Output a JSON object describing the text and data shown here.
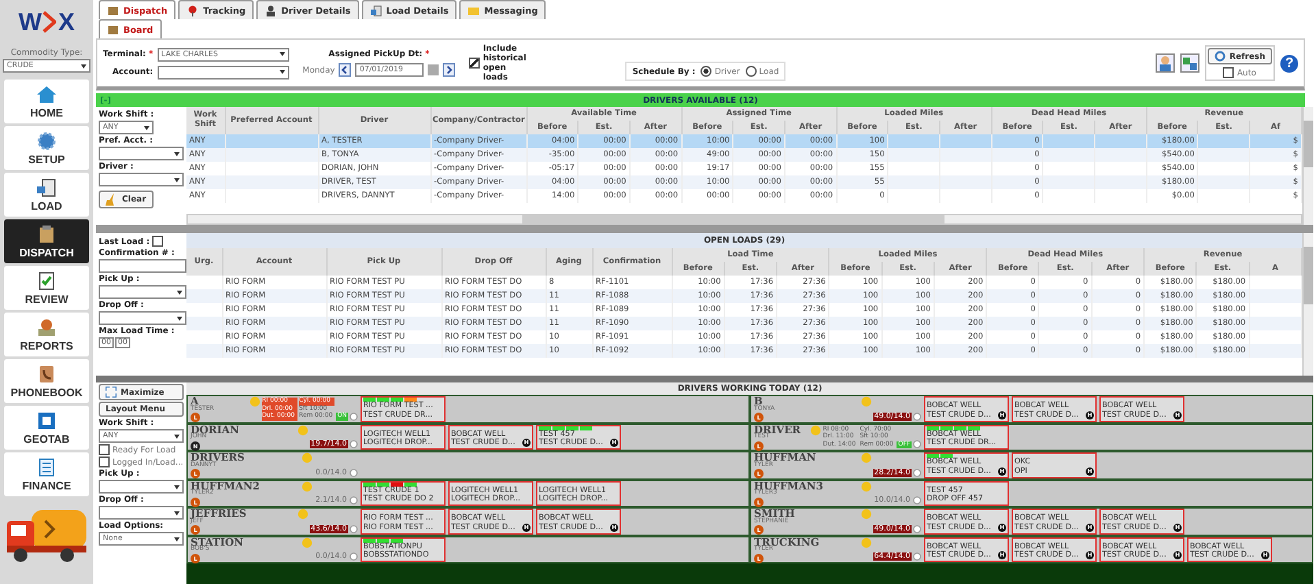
{
  "logo": {
    "left": "W",
    "right": "X"
  },
  "commodity": {
    "label": "Commodity Type:",
    "value": "CRUDE"
  },
  "nav": [
    {
      "label": "HOME",
      "selected": false
    },
    {
      "label": "SETUP",
      "selected": false
    },
    {
      "label": "LOAD",
      "selected": false
    },
    {
      "label": "DISPATCH",
      "selected": true
    },
    {
      "label": "REVIEW",
      "selected": false
    },
    {
      "label": "REPORTS",
      "selected": false
    },
    {
      "label": "PHONEBOOK",
      "selected": false
    },
    {
      "label": "GEOTAB",
      "selected": false
    },
    {
      "label": "FINANCE",
      "selected": false
    }
  ],
  "tabs": [
    {
      "label": "Dispatch",
      "selected": true
    },
    {
      "label": "Tracking",
      "selected": false
    },
    {
      "label": "Driver Details",
      "selected": false
    },
    {
      "label": "Load Details",
      "selected": false
    },
    {
      "label": "Messaging",
      "selected": false
    }
  ],
  "subtabs": [
    {
      "label": "Board",
      "selected": true
    }
  ],
  "filters": {
    "terminal": {
      "label": "Terminal:",
      "required": "*",
      "value": "LAKE CHARLES"
    },
    "account": {
      "label": "Account:"
    },
    "pickup_date": {
      "label": "Assigned PickUp Dt:",
      "required": "*",
      "day": "Monday",
      "value": "07/01/2019"
    },
    "historical": {
      "label": "Include historical open loads",
      "checked": true
    },
    "schedule_by": {
      "label": "Schedule By :",
      "options": [
        {
          "label": "Driver",
          "selected": true
        },
        {
          "label": "Load",
          "selected": false
        }
      ]
    },
    "refresh": "Refresh",
    "auto": {
      "label": "Auto",
      "checked": false
    },
    "help": "?"
  },
  "drivers_available": {
    "toggle": "[-]",
    "title": "DRIVERS AVAILABLE (12)",
    "filters": {
      "work_shift": {
        "label": "Work Shift :",
        "value": "ANY"
      },
      "pref_acct": {
        "label": "Pref. Acct. :"
      },
      "driver": {
        "label": "Driver :"
      },
      "clear": "Clear"
    },
    "columns": [
      "Work Shift",
      "Preferred Account",
      "Driver",
      "Company/Contractor"
    ],
    "groups": [
      {
        "label": "Available Time",
        "subs": [
          "Before",
          "Est.",
          "After"
        ]
      },
      {
        "label": "Assigned Time",
        "subs": [
          "Before",
          "Est.",
          "After"
        ]
      },
      {
        "label": "Loaded Miles",
        "subs": [
          "Before",
          "Est.",
          "After"
        ]
      },
      {
        "label": "Dead Head Miles",
        "subs": [
          "Before",
          "Est.",
          "After"
        ]
      },
      {
        "label": "Revenue",
        "subs": [
          "Before",
          "Est.",
          "Af"
        ]
      }
    ],
    "rows": [
      {
        "selected": true,
        "cells": [
          "ANY",
          "",
          "A, TESTER",
          "-Company Driver-",
          "04:00",
          "00:00",
          "00:00",
          "10:00",
          "00:00",
          "00:00",
          "100",
          "",
          "",
          "0",
          "",
          "",
          "$180.00",
          "",
          "$"
        ]
      },
      {
        "selected": false,
        "cells": [
          "ANY",
          "",
          "B, TONYA",
          "-Company Driver-",
          "-35:00",
          "00:00",
          "00:00",
          "49:00",
          "00:00",
          "00:00",
          "150",
          "",
          "",
          "0",
          "",
          "",
          "$540.00",
          "",
          "$"
        ]
      },
      {
        "selected": false,
        "cells": [
          "ANY",
          "",
          "DORIAN, JOHN",
          "-Company Driver-",
          "-05:17",
          "00:00",
          "00:00",
          "19:17",
          "00:00",
          "00:00",
          "155",
          "",
          "",
          "0",
          "",
          "",
          "$540.00",
          "",
          "$"
        ]
      },
      {
        "selected": false,
        "cells": [
          "ANY",
          "",
          "DRIVER, TEST",
          "-Company Driver-",
          "04:00",
          "00:00",
          "00:00",
          "10:00",
          "00:00",
          "00:00",
          "55",
          "",
          "",
          "0",
          "",
          "",
          "$180.00",
          "",
          "$"
        ]
      },
      {
        "selected": false,
        "cells": [
          "ANY",
          "",
          "DRIVERS, DANNYT",
          "-Company Driver-",
          "14:00",
          "00:00",
          "00:00",
          "00:00",
          "00:00",
          "00:00",
          "0",
          "",
          "",
          "0",
          "",
          "",
          "$0.00",
          "",
          "$"
        ]
      }
    ]
  },
  "open_loads": {
    "title": "OPEN LOADS (29)",
    "filters": {
      "last_load": {
        "label": "Last Load :",
        "checked": false
      },
      "confirmation": {
        "label": "Confirmation # :"
      },
      "pick_up": {
        "label": "Pick Up :"
      },
      "drop_off": {
        "label": "Drop Off :"
      },
      "max_load_time": {
        "label": "Max Load Time :",
        "hours": "00",
        "minutes": "00"
      }
    },
    "columns": [
      "Urg.",
      "Account",
      "Pick Up",
      "Drop Off",
      "Aging",
      "Confirmation"
    ],
    "groups": [
      {
        "label": "Load Time",
        "subs": [
          "Before",
          "Est.",
          "After"
        ]
      },
      {
        "label": "Loaded Miles",
        "subs": [
          "Before",
          "Est.",
          "After"
        ]
      },
      {
        "label": "Dead Head Miles",
        "subs": [
          "Before",
          "Est.",
          "After"
        ]
      },
      {
        "label": "Revenue",
        "subs": [
          "Before",
          "Est.",
          "A"
        ]
      }
    ],
    "rows": [
      [
        "",
        "RIO FORM",
        "RIO FORM TEST PU",
        "RIO FORM TEST DO",
        "8",
        "RF-1101",
        "10:00",
        "17:36",
        "27:36",
        "100",
        "100",
        "200",
        "0",
        "0",
        "0",
        "$180.00",
        "$180.00"
      ],
      [
        "",
        "RIO FORM",
        "RIO FORM TEST PU",
        "RIO FORM TEST DO",
        "11",
        "RF-1088",
        "10:00",
        "17:36",
        "27:36",
        "100",
        "100",
        "200",
        "0",
        "0",
        "0",
        "$180.00",
        "$180.00"
      ],
      [
        "",
        "RIO FORM",
        "RIO FORM TEST PU",
        "RIO FORM TEST DO",
        "11",
        "RF-1089",
        "10:00",
        "17:36",
        "27:36",
        "100",
        "100",
        "200",
        "0",
        "0",
        "0",
        "$180.00",
        "$180.00"
      ],
      [
        "",
        "RIO FORM",
        "RIO FORM TEST PU",
        "RIO FORM TEST DO",
        "11",
        "RF-1090",
        "10:00",
        "17:36",
        "27:36",
        "100",
        "100",
        "200",
        "0",
        "0",
        "0",
        "$180.00",
        "$180.00"
      ],
      [
        "",
        "RIO FORM",
        "RIO FORM TEST PU",
        "RIO FORM TEST DO",
        "10",
        "RF-1091",
        "10:00",
        "17:36",
        "27:36",
        "100",
        "100",
        "200",
        "0",
        "0",
        "0",
        "$180.00",
        "$180.00"
      ],
      [
        "",
        "RIO FORM",
        "RIO FORM TEST PU",
        "RIO FORM TEST DO",
        "10",
        "RF-1092",
        "10:00",
        "17:36",
        "27:36",
        "100",
        "100",
        "200",
        "0",
        "0",
        "0",
        "$180.00",
        "$180.00"
      ]
    ]
  },
  "board": {
    "title": "DRIVERS WORKING TODAY (12)",
    "controls": {
      "maximize": "Maximize",
      "layout_menu": "Layout Menu",
      "work_shift": {
        "label": "Work Shift :",
        "value": "ANY"
      },
      "ready": {
        "label": "Ready For Load",
        "checked": false
      },
      "logged_in": {
        "label": "Logged In/Load...",
        "checked": false
      },
      "pick_up": {
        "label": "Pick Up :"
      },
      "drop_off": {
        "label": "Drop Off :"
      },
      "load_options": {
        "label": "Load Options:",
        "value": "None"
      }
    },
    "columns": [
      [
        {
          "name": "A",
          "sub": "TESTER",
          "status": "L",
          "color": "#d0540a",
          "clock": {
            "duty": "ON",
            "rows": [
              [
                {
                  "label": "RI",
                  "value": "00:00",
                  "alert": true
                },
                {
                  "label": "Cyl.",
                  "value": "00:00",
                  "alert": true
                }
              ],
              [
                {
                  "label": "Drl.",
                  "value": "00:00",
                  "alert": true
                },
                {
                  "label": "Sft",
                  "value": "10:00",
                  "alert": false
                }
              ],
              [
                {
                  "label": "Dut.",
                  "value": "00:00",
                  "alert": true
                },
                {
                  "label": "Rem",
                  "value": "00:00",
                  "alert": false
                }
              ]
            ]
          },
          "loads": [
            {
              "line1": "RIO FORM TEST ...",
              "line2": "TEST CRUDE DR...",
              "segments": [
                {
                  "color": "#33dd33"
                },
                {
                  "color": "#33dd33"
                },
                {
                  "color": "#33dd33"
                },
                {
                  "color": "#ff8a1a"
                }
              ]
            }
          ]
        },
        {
          "name": "DORIAN",
          "sub": "JOHN",
          "status": "N",
          "color": "#222222",
          "hours": "19.7/14.0",
          "over": true,
          "loads": [
            {
              "line1": "LOGITECH WELL1",
              "line2": "LOGITECH DROP..."
            },
            {
              "line1": "BOBCAT WELL",
              "line2": "TEST CRUDE D...",
              "hazmat": "H"
            },
            {
              "line1": "TEST 457",
              "line2": "TEST CRUDE D...",
              "hazmat": "H",
              "segments": [
                {
                  "color": "#33dd33"
                },
                {
                  "color": "#33dd33"
                },
                {
                  "color": "#33dd33"
                },
                {
                  "color": "#33dd33"
                }
              ]
            }
          ]
        },
        {
          "name": "DRIVERS",
          "sub": "DANNYT",
          "status": "L",
          "color": "#d0540a",
          "hours": "0.0/14.0",
          "over": false
        },
        {
          "name": "HUFFMAN2",
          "sub": "TYLER2",
          "status": "L",
          "color": "#d0540a",
          "hours": "2.1/14.0",
          "over": false,
          "loads": [
            {
              "line1": "TEST CRUDE 1",
              "line2": "TEST CRUDE DO 2",
              "segments": [
                {
                  "color": "#33dd33"
                },
                {
                  "color": "#33dd33"
                },
                {
                  "color": "#e01010"
                },
                {
                  "color": "#33dd33"
                }
              ]
            },
            {
              "line1": "LOGITECH WELL1",
              "line2": "LOGITECH DROP..."
            },
            {
              "line1": "LOGITECH WELL1",
              "line2": "LOGITECH DROP..."
            }
          ]
        },
        {
          "name": "JEFFRIES",
          "sub": "JEFF",
          "status": "L",
          "color": "#d0540a",
          "hours": "43.6/14.0",
          "over": true,
          "loads": [
            {
              "line1": "RIO FORM TEST ...",
              "line2": "RIO FORM TEST ..."
            },
            {
              "line1": "BOBCAT WELL",
              "line2": "TEST CRUDE D...",
              "hazmat": "H"
            },
            {
              "line1": "BOBCAT WELL",
              "line2": "TEST CRUDE D...",
              "hazmat": "H"
            }
          ]
        },
        {
          "name": "STATION",
          "sub": "BOB'S",
          "status": "L",
          "color": "#d0540a",
          "hours": "0.0/14.0",
          "over": false,
          "loads": [
            {
              "line1": "BOBSTATIONPU",
              "line2": "BOBSSTATIONDO",
              "segments": [
                {
                  "color": "#33dd33"
                },
                {
                  "color": "#33dd33"
                },
                {
                  "color": "#33dd33"
                }
              ]
            }
          ]
        }
      ],
      [
        {
          "name": "B",
          "sub": "TONYA",
          "status": "L",
          "color": "#d0540a",
          "hours": "49.0/14.0",
          "over": true,
          "loads": [
            {
              "line1": "BOBCAT WELL",
              "line2": "TEST CRUDE D...",
              "hazmat": "H"
            },
            {
              "line1": "BOBCAT WELL",
              "line2": "TEST CRUDE D...",
              "hazmat": "H"
            },
            {
              "line1": "BOBCAT WELL",
              "line2": "TEST CRUDE D...",
              "hazmat": "H"
            }
          ]
        },
        {
          "name": "DRIVER",
          "sub": "TEST",
          "status": "L",
          "color": "#d0540a",
          "clock": {
            "duty": "OFF",
            "rows": [
              [
                {
                  "label": "RI",
                  "value": "08:00",
                  "alert": false
                },
                {
                  "label": "Cyl.",
                  "value": "70:00",
                  "alert": false
                }
              ],
              [
                {
                  "label": "Drl.",
                  "value": "11:00",
                  "alert": false
                },
                {
                  "label": "Sft",
                  "value": "10:00",
                  "alert": false
                }
              ],
              [
                {
                  "label": "Dut.",
                  "value": "14:00",
                  "alert": false
                },
                {
                  "label": "Rem",
                  "value": "00:00",
                  "alert": false
                }
              ]
            ]
          },
          "loads": [
            {
              "line1": "BOBCAT WELL",
              "line2": "TEST CRUDE DR...",
              "segments": [
                {
                  "color": "#33dd33"
                },
                {
                  "color": "#33dd33"
                },
                {
                  "color": "#33dd33"
                },
                {
                  "color": "#33dd33"
                }
              ]
            }
          ]
        },
        {
          "name": "HUFFMAN",
          "sub": "TYLER",
          "status": "L",
          "color": "#d0540a",
          "hours": "28.2/14.0",
          "over": true,
          "loads": [
            {
              "line1": "BOBCAT WELL",
              "line2": "TEST CRUDE D...",
              "hazmat": "H",
              "segments": [
                {
                  "color": "#33dd33"
                },
                {
                  "color": "#33dd33"
                }
              ]
            },
            {
              "line1": "OKC",
              "line2": "OPI",
              "hazmat": "H"
            }
          ]
        },
        {
          "name": "HUFFMAN3",
          "sub": "TYLER3",
          "status": "L",
          "color": "#d0540a",
          "hours": "10.0/14.0",
          "over": false,
          "loads": [
            {
              "line1": "TEST 457",
              "line2": "DROP OFF 457"
            }
          ]
        },
        {
          "name": "SMITH",
          "sub": "STEPHANIE",
          "status": "L",
          "color": "#d0540a",
          "hours": "49.0/14.0",
          "over": true,
          "loads": [
            {
              "line1": "BOBCAT WELL",
              "line2": "TEST CRUDE D...",
              "hazmat": "H"
            },
            {
              "line1": "BOBCAT WELL",
              "line2": "TEST CRUDE D...",
              "hazmat": "H"
            },
            {
              "line1": "BOBCAT WELL",
              "line2": "TEST CRUDE D...",
              "hazmat": "H"
            }
          ]
        },
        {
          "name": "TRUCKING",
          "sub": "TYLER",
          "status": "L",
          "color": "#d0540a",
          "hours": "64.4/14.0",
          "over": true,
          "loads": [
            {
              "line1": "BOBCAT WELL",
              "line2": "TEST CRUDE D...",
              "hazmat": "H"
            },
            {
              "line1": "BOBCAT WELL",
              "line2": "TEST CRUDE D...",
              "hazmat": "H"
            },
            {
              "line1": "BOBCAT WELL",
              "line2": "TEST CRUDE D...",
              "hazmat": "H"
            },
            {
              "line1": "BOBCAT WELL",
              "line2": "TEST CRUDE D...",
              "hazmat": "H"
            }
          ]
        }
      ]
    ]
  }
}
